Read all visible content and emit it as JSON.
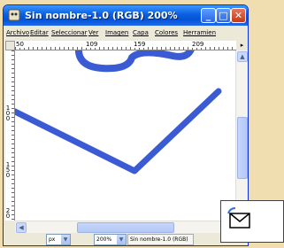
{
  "window": {
    "title": "Sin nombre-1.0 (RGB) 200%"
  },
  "menu": {
    "items": [
      "Archivo",
      "Editar",
      "Seleccionar",
      "Ver",
      "Imagen",
      "Capa",
      "Colores",
      "Herramien"
    ]
  },
  "ruler_top": {
    "labels": [
      "50",
      "109",
      "159",
      "209"
    ]
  },
  "ruler_left": {
    "labels": [
      "1",
      "0",
      "0",
      "1",
      "5",
      "0",
      "2",
      "0",
      "0"
    ]
  },
  "status": {
    "unit": "px",
    "zoom": "200%",
    "info": "Sin nombre-1.0 (RGB)"
  },
  "colors": {
    "stroke": "#3a5bd4",
    "title_bar": "#0a5fe0",
    "background": "#f1deb0"
  },
  "icons": {
    "app": "gimp-icon",
    "minimize": "minimize-icon",
    "maximize": "maximize-icon",
    "close": "close-icon",
    "navigate": "navigate-icon"
  }
}
